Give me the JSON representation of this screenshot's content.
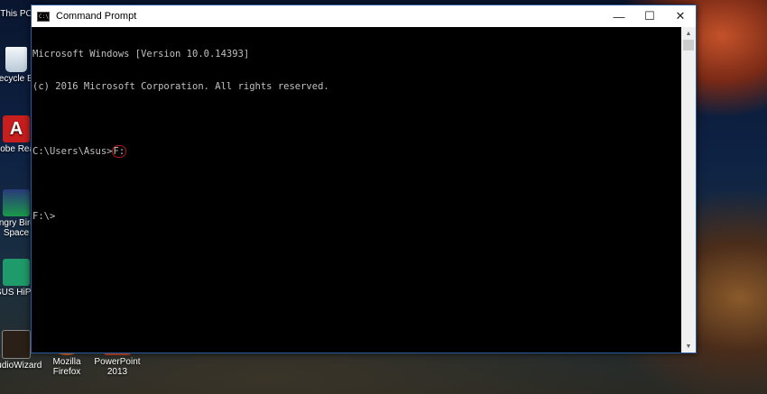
{
  "desktop": {
    "icons": [
      {
        "name": "this-pc",
        "label": "This PC",
        "color": "#3a78c8"
      },
      {
        "name": "recycle-bin",
        "label": "Recycle Bin",
        "color": "#dfe8f0"
      },
      {
        "name": "adobe-reader",
        "label": "Adobe Reader X",
        "color": "#c81e1e"
      },
      {
        "name": "angry-birds",
        "label": "Angry Birds Space",
        "color": "#2a3a7a"
      },
      {
        "name": "asus-hipost",
        "label": "ASUS HiPost",
        "color": "#1f9a6a"
      },
      {
        "name": "audiowizard",
        "label": "AudioWizard",
        "color": "#3a2a1a"
      },
      {
        "name": "firefox",
        "label": "Mozilla Firefox",
        "color": "#e8681c"
      },
      {
        "name": "powerpoint",
        "label": "PowerPoint 2013",
        "color": "#d24726"
      }
    ]
  },
  "window": {
    "title": "Command Prompt",
    "icon_text": "C:\\",
    "minimize": "—",
    "maximize": "☐",
    "close": "✕"
  },
  "console": {
    "line1": "Microsoft Windows [Version 10.0.14393]",
    "line2": "(c) 2016 Microsoft Corporation. All rights reserved.",
    "line3_prompt": "C:\\Users\\Asus>",
    "line3_cmd": "F:",
    "line4": "F:\\>"
  },
  "scrollbar": {
    "up": "▲",
    "down": "▼"
  }
}
